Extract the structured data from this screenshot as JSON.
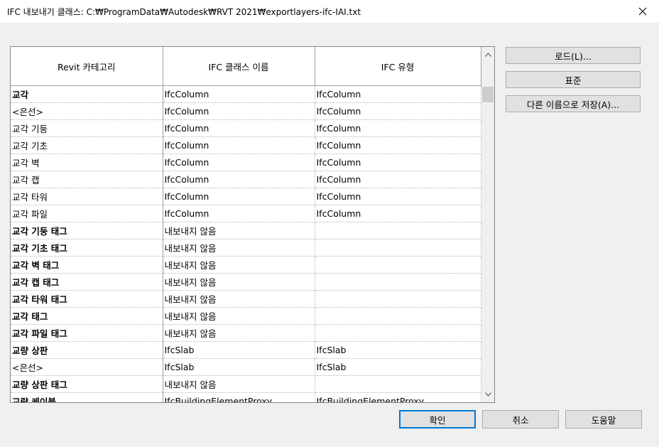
{
  "window": {
    "title": "IFC 내보내기 클래스: C:₩ProgramData₩Autodesk₩RVT 2021₩exportlayers-ifc-IAI.txt"
  },
  "grid": {
    "headers": [
      "Revit 카테고리",
      "IFC 클래스 이름",
      "IFC 유형"
    ],
    "rows": [
      {
        "cat": "교각",
        "cls": "IfcColumn",
        "type": "IfcColumn",
        "level": 0
      },
      {
        "cat": "<은선>",
        "cls": "IfcColumn",
        "type": "IfcColumn",
        "level": 1
      },
      {
        "cat": "교각 기둥",
        "cls": "IfcColumn",
        "type": "IfcColumn",
        "level": 1
      },
      {
        "cat": "교각 기초",
        "cls": "IfcColumn",
        "type": "IfcColumn",
        "level": 1
      },
      {
        "cat": "교각 벽",
        "cls": "IfcColumn",
        "type": "IfcColumn",
        "level": 1
      },
      {
        "cat": "교각 캡",
        "cls": "IfcColumn",
        "type": "IfcColumn",
        "level": 1
      },
      {
        "cat": "교각 타워",
        "cls": "IfcColumn",
        "type": "IfcColumn",
        "level": 1
      },
      {
        "cat": "교각 파일",
        "cls": "IfcColumn",
        "type": "IfcColumn",
        "level": 1
      },
      {
        "cat": "교각 기둥 태그",
        "cls": "내보내지 않음",
        "type": "",
        "level": 0
      },
      {
        "cat": "교각 기초 태그",
        "cls": "내보내지 않음",
        "type": "",
        "level": 0
      },
      {
        "cat": "교각 벽 태그",
        "cls": "내보내지 않음",
        "type": "",
        "level": 0
      },
      {
        "cat": "교각 캡 태그",
        "cls": "내보내지 않음",
        "type": "",
        "level": 0
      },
      {
        "cat": "교각 타워 태그",
        "cls": "내보내지 않음",
        "type": "",
        "level": 0
      },
      {
        "cat": "교각 태그",
        "cls": "내보내지 않음",
        "type": "",
        "level": 0
      },
      {
        "cat": "교각 파일 태그",
        "cls": "내보내지 않음",
        "type": "",
        "level": 0
      },
      {
        "cat": "교량 상판",
        "cls": "IfcSlab",
        "type": "IfcSlab",
        "level": 0
      },
      {
        "cat": "<은선>",
        "cls": "IfcSlab",
        "type": "IfcSlab",
        "level": 1
      },
      {
        "cat": "교량 상판 태그",
        "cls": "내보내지 않음",
        "type": "",
        "level": 0
      },
      {
        "cat": "교량 케이블",
        "cls": "IfcBuildingElementProxy",
        "type": "IfcBuildingElementProxy",
        "level": 0
      }
    ]
  },
  "side_buttons": {
    "load": "로드(L)...",
    "standard": "표준",
    "save_as": "다른 이름으로 저장(A)..."
  },
  "bottom_buttons": {
    "ok": "확인",
    "cancel": "취소",
    "help": "도움말"
  },
  "colors": {
    "default_button_border": "#0078d7",
    "grid_border": "#828790"
  }
}
